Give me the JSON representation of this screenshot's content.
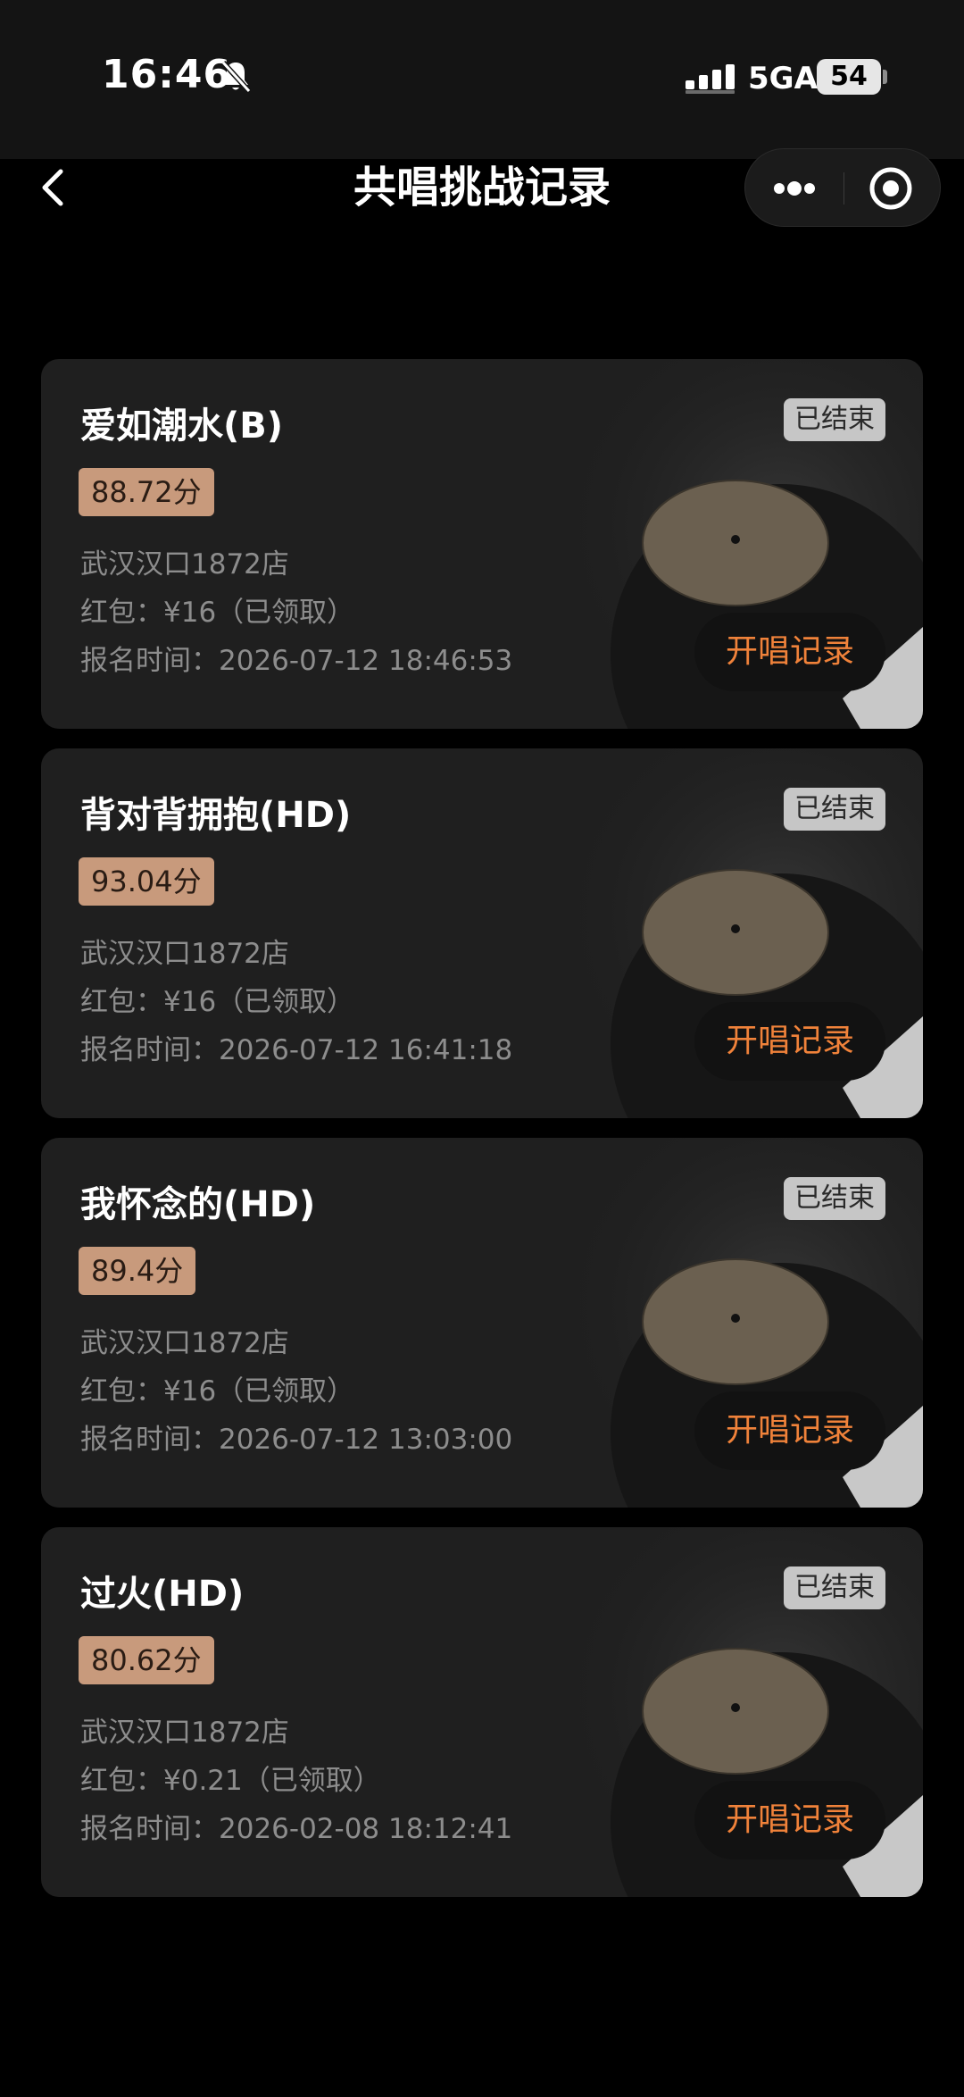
{
  "status_bar": {
    "time": "16:46",
    "network": "5GA",
    "battery": "54"
  },
  "nav": {
    "title": "共唱挑战记录"
  },
  "records": [
    {
      "title": "爱如潮水(B)",
      "status": "已结束",
      "score": "88.72分",
      "store": "武汉汉口1872店",
      "red_packet": "红包：¥16（已领取）",
      "signup_time": "报名时间：2026-07-12 18:46:53",
      "action_label": "开唱记录"
    },
    {
      "title": "背对背拥抱(HD)",
      "status": "已结束",
      "score": "93.04分",
      "store": "武汉汉口1872店",
      "red_packet": "红包：¥16（已领取）",
      "signup_time": "报名时间：2026-07-12 16:41:18",
      "action_label": "开唱记录"
    },
    {
      "title": "我怀念的(HD)",
      "status": "已结束",
      "score": "89.4分",
      "store": "武汉汉口1872店",
      "red_packet": "红包：¥16（已领取）",
      "signup_time": "报名时间：2026-07-12 13:03:00",
      "action_label": "开唱记录"
    },
    {
      "title": "过火(HD)",
      "status": "已结束",
      "score": "80.62分",
      "store": "武汉汉口1872店",
      "red_packet": "红包：¥0.21（已领取）",
      "signup_time": "报名时间：2026-02-08 18:12:41",
      "action_label": "开唱记录"
    }
  ],
  "colors": {
    "background": "#000000",
    "card": "#1f1f1f",
    "score_badge": "#c89a7c",
    "status_badge": "#c6c6c6",
    "accent_orange": "#f0823a",
    "muted_text": "#8d8d8d"
  },
  "icons": {
    "back": "chevron-left-icon",
    "more": "more-dots-icon",
    "close": "target-circle-icon",
    "bell": "bell-slash-icon",
    "signal": "signal-bars-icon",
    "art": "vinyl-record-icon"
  }
}
